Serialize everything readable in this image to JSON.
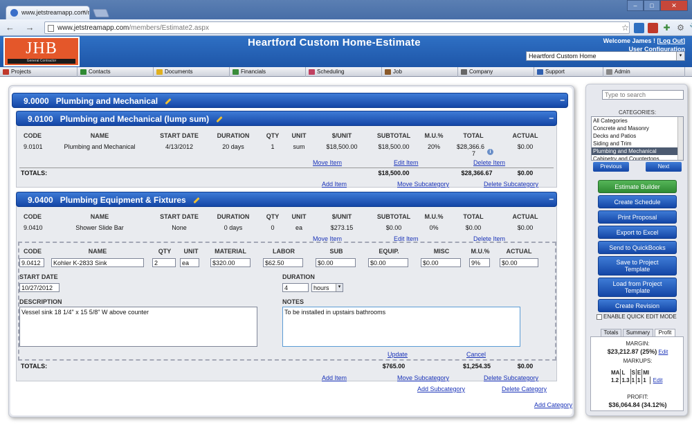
{
  "browser": {
    "tab_title": "www.jetstreamapp.com/m",
    "tab_close": "×",
    "url_host": "www.jetstreamapp.com",
    "url_path": "/members/Estimate2.aspx",
    "win_min": "–",
    "win_max": "□",
    "win_close": "✕",
    "nav_glyphs": "← → C",
    "ext_icons": [
      "star-icon",
      "box-icon",
      "flash-icon",
      "puzzle-icon",
      "gear-icon",
      "wrench-icon"
    ]
  },
  "app": {
    "logo_text": "JHB",
    "logo_sub": "General Contractor",
    "title": "Heartford Custom Home-Estimate",
    "welcome": "Welcome James ! [",
    "logout": "Log Out",
    "welcome_end": "]",
    "user_config": "User Configuration",
    "project_select": "Heartford Custom Home",
    "dd": "▾"
  },
  "menu": [
    {
      "label": "Projects",
      "icon": "projects-icon",
      "color": "#c0392b",
      "w": 112
    },
    {
      "label": "Contacts",
      "icon": "contacts-icon",
      "color": "#2f8a33",
      "w": 110
    },
    {
      "label": "Documents",
      "icon": "documents-icon",
      "color": "#e0b020",
      "w": 110
    },
    {
      "label": "Financials",
      "icon": "financials-icon",
      "color": "#3a8c3a",
      "w": 110
    },
    {
      "label": "Scheduling",
      "icon": "scheduling-icon",
      "color": "#c04060",
      "w": 110
    },
    {
      "label": "Job",
      "icon": "job-icon",
      "color": "#8a5a2a",
      "w": 110
    },
    {
      "label": "Company",
      "icon": "company-icon",
      "color": "#666666",
      "w": 110
    },
    {
      "label": "Support",
      "icon": "support-icon",
      "color": "#3060b0",
      "w": 100
    },
    {
      "label": "Admin",
      "icon": "admin-icon",
      "color": "#888888",
      "w": 118
    }
  ],
  "category": {
    "code": "9.0000",
    "name": "Plumbing and Mechanical",
    "collapse": "–",
    "add_subcategory": "Add Subcategory",
    "delete_category": "Delete Category",
    "add_category": "Add Category"
  },
  "columns": {
    "code": "CODE",
    "name": "NAME",
    "start": "START DATE",
    "duration": "DURATION",
    "qty": "QTY",
    "unit": "UNIT",
    "per_unit": "$/UNIT",
    "subtotal": "SUBTOTAL",
    "mu": "M.U.%",
    "total": "TOTAL",
    "actual": "ACTUAL"
  },
  "sub1": {
    "code": "9.0100",
    "name": "Plumbing and Mechanical (lump sum)",
    "collapse": "–",
    "row": {
      "code": "9.0101",
      "name": "Plumbing and Mechanical",
      "start": "4/13/2012",
      "duration": "20 days",
      "qty": "1",
      "unit": "sum",
      "per_unit": "$18,500.00",
      "subtotal": "$18,500.00",
      "mu": "20%",
      "total_a": "$28,366.6",
      "total_b": "7",
      "info": "i",
      "actual": "$0.00"
    },
    "move_item": "Move Item",
    "edit_item": "Edit Item",
    "delete_item": "Delete Item",
    "totals_label": "TOTALS:",
    "totals_subtotal": "$18,500.00",
    "totals_total": "$28,366.67",
    "totals_actual": "$0.00",
    "add_item": "Add Item",
    "move_subcategory": "Move Subcategory",
    "delete_subcategory": "Delete Subcategory"
  },
  "sub2": {
    "code": "9.0400",
    "name": "Plumbing Equipment & Fixtures",
    "collapse": "–",
    "row": {
      "code": "9.0410",
      "name": "Shower Slide Bar",
      "start": "None",
      "duration": "0 days",
      "qty": "0",
      "unit": "ea",
      "per_unit": "$273.15",
      "subtotal": "$0.00",
      "mu": "0%",
      "total": "$0.00",
      "actual": "$0.00"
    },
    "move_item": "Move Item",
    "edit_item": "Edit Item",
    "delete_item": "Delete Item",
    "edit": {
      "h_code": "CODE",
      "h_name": "NAME",
      "h_qty": "QTY",
      "h_unit": "UNIT",
      "h_material": "MATERIAL",
      "h_labor": "LABOR",
      "h_sub": "SUB",
      "h_equip": "EQUIP.",
      "h_misc": "MISC",
      "h_mu": "M.U.%",
      "h_actual": "ACTUAL",
      "code": "9.0412",
      "name": "Kohler K-2833 Sink",
      "qty": "2",
      "unit": "ea",
      "material": "$320.00",
      "labor": "$62.50",
      "sub": "$0.00",
      "equip": "$0.00",
      "misc": "$0.00",
      "mu": "9%",
      "actual": "$0.00",
      "start_label": "START DATE",
      "start": "10/27/2012",
      "duration_label": "DURATION",
      "duration": "4",
      "duration_unit": "hours",
      "desc_label": "DESCRIPTION",
      "desc": "Vessel sink 18 1/4\" x 15 5/8\" W above counter",
      "notes_label": "NOTES",
      "notes": "To be installed in upstairs bathrooms",
      "update": "Update",
      "cancel": "Cancel"
    },
    "totals_label": "TOTALS:",
    "totals_subtotal": "$765.00",
    "totals_total": "$1,254.35",
    "totals_actual": "$0.00",
    "add_item": "Add Item",
    "move_subcategory": "Move Subcategory",
    "delete_subcategory": "Delete Subcategory"
  },
  "side": {
    "search_placeholder": "Type to search",
    "categories_label": "CATEGORIES:",
    "categories": [
      "All Categories",
      "Concrete and Masonry",
      "Decks and Patios",
      "Siding and Trim",
      "Plumbing and Mechanical",
      "Cabinetry and Countertops"
    ],
    "selected_index": 4,
    "previous": "Previous",
    "next": "Next",
    "buttons": [
      {
        "label": "Estimate Builder",
        "green": true
      },
      {
        "label": "Create Schedule"
      },
      {
        "label": "Print Proposal"
      },
      {
        "label": "Export to Excel"
      },
      {
        "label": "Send to QuickBooks"
      },
      {
        "label": "Save to Project Template",
        "two": true
      },
      {
        "label": "Load from Project Template",
        "two": true
      },
      {
        "label": "Create Revision"
      }
    ],
    "quick_edit": "ENABLE QUICK EDIT MODE",
    "tabs": [
      "Totals",
      "Summary",
      "Profit"
    ],
    "active_tab": 2,
    "margin_label": "MARGIN:",
    "margin_value": "$23,212.87 (25%)",
    "edit": "Edit",
    "markups_label": "MARKUPS:",
    "markup_heads": [
      "MA",
      "L",
      "S",
      "E",
      "MI"
    ],
    "markup_vals": [
      "1.2",
      "1.3",
      "1",
      "1",
      "1"
    ],
    "profit_label": "PROFIT:",
    "profit_value": "$36,064.84 (34.12%)"
  }
}
